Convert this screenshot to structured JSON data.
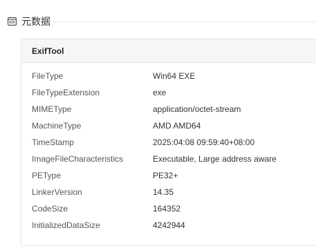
{
  "section": {
    "title": "元数据",
    "icon": "code-view-icon"
  },
  "exif": {
    "title": "ExifTool",
    "rows": [
      {
        "key": "FileType",
        "value": "Win64 EXE"
      },
      {
        "key": "FileTypeExtension",
        "value": "exe"
      },
      {
        "key": "MIMEType",
        "value": "application/octet-stream"
      },
      {
        "key": "MachineType",
        "value": "AMD AMD64"
      },
      {
        "key": "TimeStamp",
        "value": "2025:04:08 09:59:40+08:00"
      },
      {
        "key": "ImageFileCharacteristics",
        "value": "Executable, Large address aware"
      },
      {
        "key": "PEType",
        "value": "PE32+"
      },
      {
        "key": "LinkerVersion",
        "value": "14.35"
      },
      {
        "key": "CodeSize",
        "value": "164352"
      },
      {
        "key": "InitializedDataSize",
        "value": "4242944"
      }
    ]
  }
}
